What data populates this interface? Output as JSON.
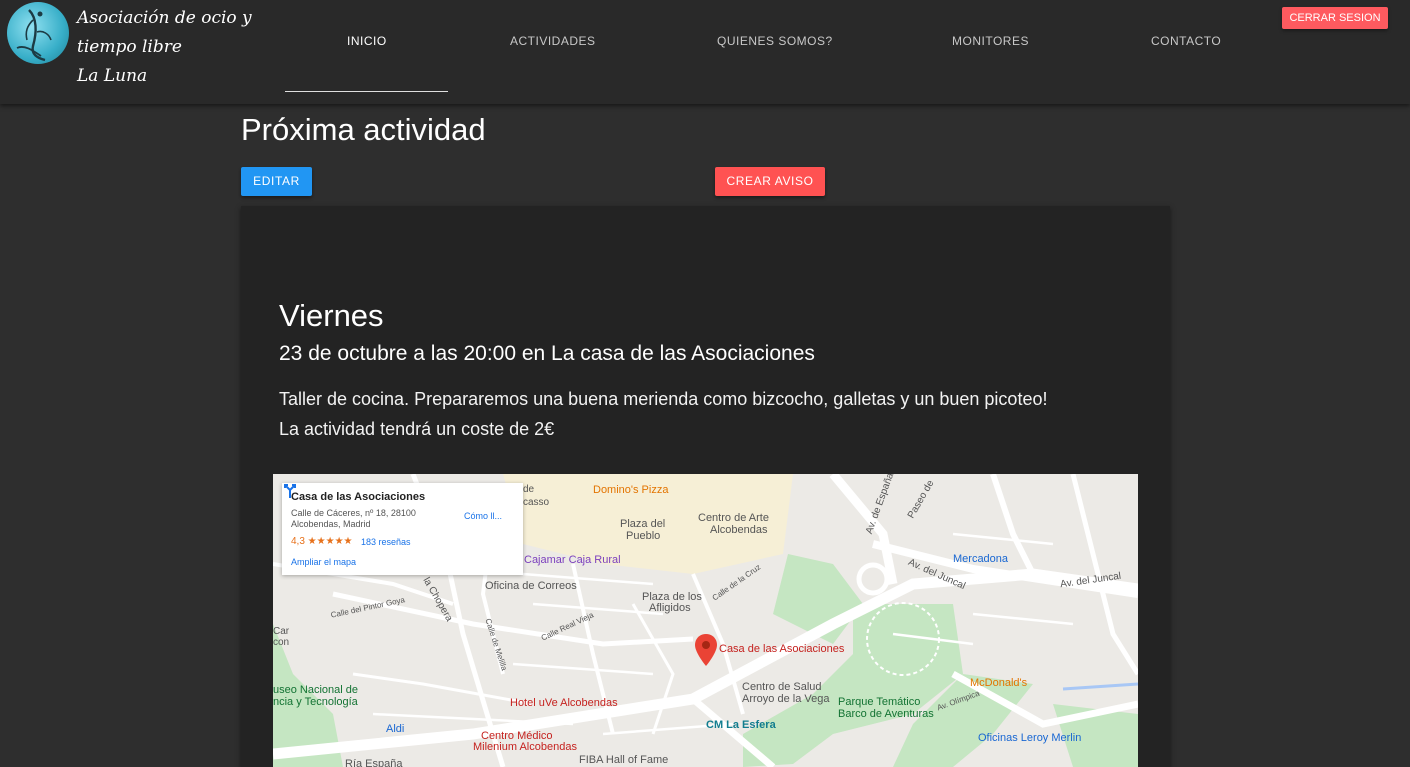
{
  "brand": {
    "line1": "Asociación de ocio y",
    "line2": "tiempo libre",
    "line3": "La Luna"
  },
  "nav": {
    "items": [
      "INICIO",
      "ACTIVIDADES",
      "QUIENES SOMOS?",
      "MONITORES",
      "CONTACTO"
    ],
    "active": "INICIO",
    "logout_label": "CERRAR SESION"
  },
  "page": {
    "title": "Próxima actividad",
    "edit_label": "EDITAR",
    "alert_label": "CREAR AVISO"
  },
  "activity": {
    "day": "Viernes",
    "date_place": "23 de octubre a las 20:00 en La casa de las Asociaciones",
    "description_line1": "Taller de cocina. Prepararemos una buena merienda como bizcocho, galletas y un buen picoteo!",
    "description_line2": "La actividad tendrá un coste de 2€"
  },
  "map": {
    "place_name": "Casa de las Asociaciones",
    "address_line1": "Calle de Cáceres, nº 18, 28100",
    "address_line2": "Alcobendas, Madrid",
    "rating": "4,3 ★★★★★",
    "reviews": "183 reseñas",
    "directions": "Cómo ll...",
    "expand": "Ampliar el mapa",
    "marker_label": "Casa de las Asociaciones",
    "labels": {
      "dominos": "Domino's Pizza",
      "plaza_pueblo_1": "Plaza del",
      "plaza_pueblo_2": "Pueblo",
      "centro_arte_1": "Centro de Arte",
      "centro_arte_2": "Alcobendas",
      "mercadona": "Mercadona",
      "cajamar": "Cajamar Caja Rural",
      "correos": "Oficina de Correos",
      "plaza_afligidos_1": "Plaza de los",
      "plaza_afligidos_2": "Afligidos",
      "av_juncal_1": "Av. del Juncal",
      "av_juncal_2": "Av. del Juncal",
      "mcdonalds": "McDonald's",
      "centro_salud_1": "Centro de Salud",
      "centro_salud_2": "Arroyo de la Vega",
      "parque_1": "Parque Temático",
      "parque_2": "Barco de Aventuras",
      "museo_1": "useo Nacional de",
      "museo_2": "ncia y Tecnología",
      "hotel": "Hotel uVe Alcobendas",
      "cm_esfera": "CM La Esfera",
      "aldi": "Aldi",
      "centro_medico_1": "Centro Médico",
      "centro_medico_2": "Milenium Alcobendas",
      "leroy": "Oficinas Leroy Merlin",
      "fiba": "FIBA Hall of Fame",
      "ria": "Ría España",
      "car_1": "Car",
      "car_2": "con",
      "pintor_goya": "Calle del Pintor Goya",
      "real_vieja": "Calle Real Vieja",
      "melilla": "Calle de Melilla",
      "la_chopera": "la Chopera",
      "calle_cruz": "Calle de la Cruz",
      "paseo_de": "Paseo de",
      "av_espana": "Av. de España",
      "av_olimpica": "Av. Olímpica",
      "asso_de": "de",
      "asso_casso": "casso"
    }
  },
  "colors": {
    "nav_bg": "#292929",
    "page_bg": "#2e2e2e",
    "card_bg": "#232323",
    "edit_btn": "#2196f3",
    "alert_btn": "#ff5252",
    "logout_btn": "#ff5a5f",
    "marker": "#ea4335"
  }
}
